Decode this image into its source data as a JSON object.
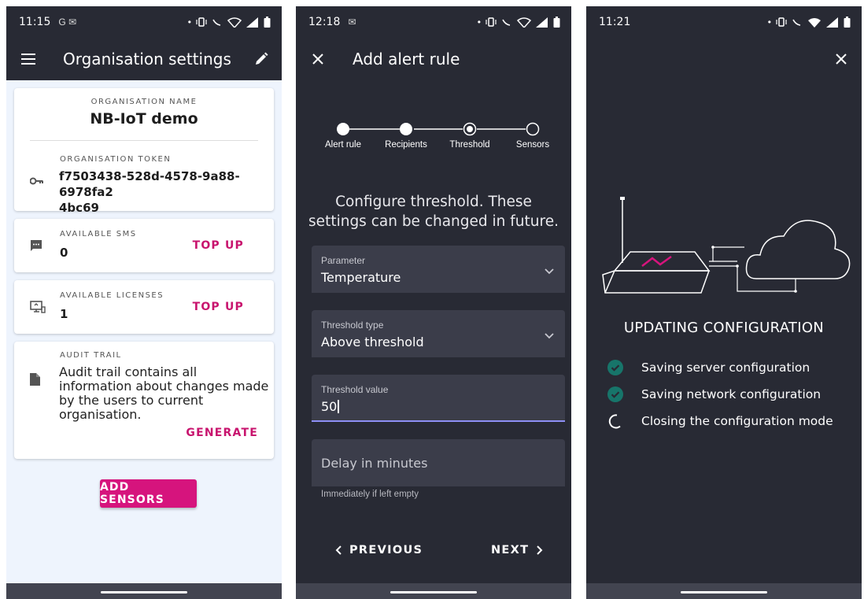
{
  "screen1": {
    "status": {
      "time": "11:15",
      "notif": "G ✉"
    },
    "title": "Organisation settings",
    "org_name_label": "ORGANISATION NAME",
    "org_name": "NB-IoT demo",
    "org_token_label": "ORGANISATION TOKEN",
    "org_token_line1": "f7503438-528d-4578-9a88-6978fa2",
    "org_token_line2": "4bc69",
    "sms_label": "AVAILABLE SMS",
    "sms_value": "0",
    "sms_topup": "TOP UP",
    "lic_label": "AVAILABLE LICENSES",
    "lic_value": "1",
    "lic_topup": "TOP UP",
    "audit_label": "AUDIT TRAIL",
    "audit_text": "Audit trail contains all information about changes made by the users to current organisation.",
    "generate": "GENERATE",
    "add_sensors": "ADD SENSORS"
  },
  "screen2": {
    "status": {
      "time": "12:18",
      "notif": "✉"
    },
    "title": "Add alert rule",
    "steps": [
      "Alert rule",
      "Recipients",
      "Threshold",
      "Sensors"
    ],
    "heading_line1": "Configure threshold. These",
    "heading_line2": "settings can be changed in future.",
    "parameter_label": "Parameter",
    "parameter_value": "Temperature",
    "threshold_type_label": "Threshold type",
    "threshold_type_value": "Above threshold",
    "threshold_value_label": "Threshold value",
    "threshold_value": "50",
    "delay_label": "Delay in minutes",
    "delay_helper": "Immediately if left empty",
    "previous": "PREVIOUS",
    "next": "NEXT"
  },
  "screen3": {
    "status": {
      "time": "11:21"
    },
    "title": "UPDATING CONFIGURATION",
    "items": [
      "Saving server configuration",
      "Saving network configuration",
      "Closing the configuration mode"
    ]
  },
  "colors": {
    "dark_bg": "#282a34",
    "accent": "#d6147d",
    "accent_text": "#c8146e",
    "success": "#17756a",
    "field_bg": "#3b3d4a",
    "focus_line": "#8e8ff5",
    "light_bg": "#eef4fd"
  },
  "icons": [
    "menu-icon",
    "edit-icon",
    "key-icon",
    "sms-icon",
    "license-icon",
    "document-icon",
    "close-icon",
    "chevron-down-icon",
    "chevron-left-icon",
    "chevron-right-icon",
    "check-circle-icon",
    "spinner-icon",
    "router-cloud-illustration"
  ]
}
